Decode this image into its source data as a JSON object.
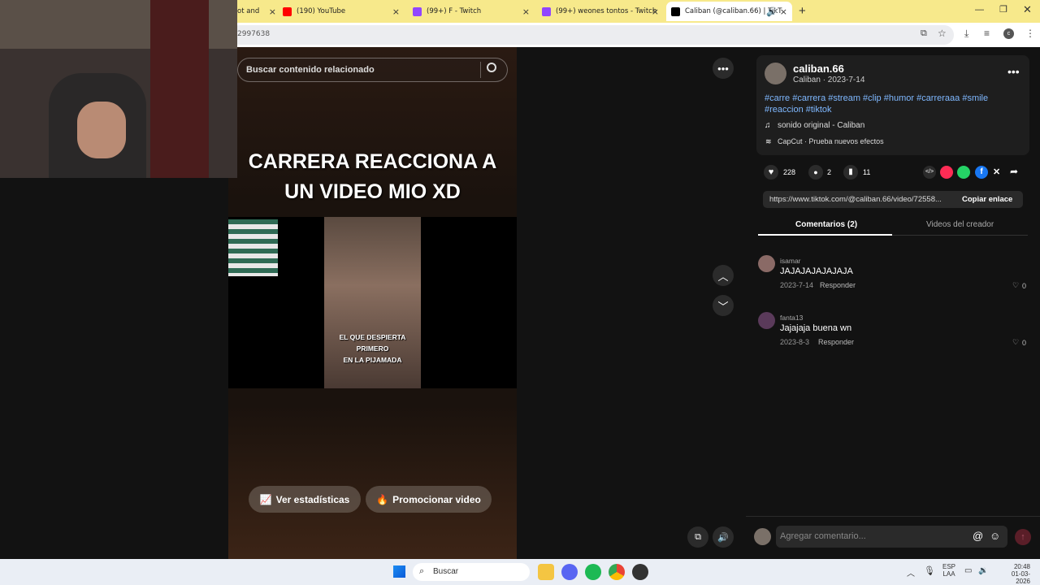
{
  "tabs": [
    {
      "title": "ot and",
      "icon": "globe-icon"
    },
    {
      "title": "(190) YouTube",
      "icon": "youtube-icon"
    },
    {
      "title": "(99+) F - Twitch",
      "icon": "twitch-icon"
    },
    {
      "title": "(99+) weones tontos - Twitch",
      "icon": "twitch-icon"
    },
    {
      "title": "Caliban (@caliban.66) | TikT",
      "icon": "tiktok-icon"
    }
  ],
  "address": {
    "url_fragment": "2997638"
  },
  "video": {
    "search_placeholder": "Buscar contenido relacionado",
    "caption_line1": "CARRERA REACCIONA A",
    "caption_line2": "UN VIDEO MIO XD",
    "subtitle_line1": "EL QUE DESPIERTA PRIMERO",
    "subtitle_line2": "EN LA PIJAMADA",
    "stats_label": "Ver estadísticas",
    "promote_label": "Promocionar video"
  },
  "author": {
    "username": "caliban.66",
    "display_meta": "Caliban · 2023-7-14",
    "hashtags_line1": "#carre #carrera #stream #clip #humor #carreraaa #smile",
    "hashtags_line2": "#reaccion #tiktok",
    "sound": "sonido original - Caliban",
    "effect": "CapCut · Prueba nuevos efectos"
  },
  "stats": {
    "likes": "228",
    "comments": "2",
    "saves": "11"
  },
  "link": {
    "url": "https://www.tiktok.com/@caliban.66/video/72558...",
    "copy_label": "Copiar enlace"
  },
  "panel_tabs": {
    "comments": "Comentarios (2)",
    "creator_videos": "Videos del creador"
  },
  "comments": [
    {
      "user": "isamar",
      "text": "JAJAJAJAJAJAJA",
      "date": "2023-7-14",
      "reply": "Responder",
      "likes": "0"
    },
    {
      "user": "fanta13",
      "text": "Jajajaja buena wn",
      "date": "2023-8-3",
      "reply": "Responder",
      "likes": "0"
    }
  ],
  "comment_input": {
    "placeholder": "Agregar comentario..."
  },
  "taskbar": {
    "search": "Buscar",
    "lang1": "ESP",
    "lang2": "LAA",
    "time": "20:48",
    "date": "01-03-2026"
  },
  "colors": {
    "accent": "#fe2c55",
    "tab_bar": "#f7e98b",
    "hashtag": "#7fb8ff"
  }
}
